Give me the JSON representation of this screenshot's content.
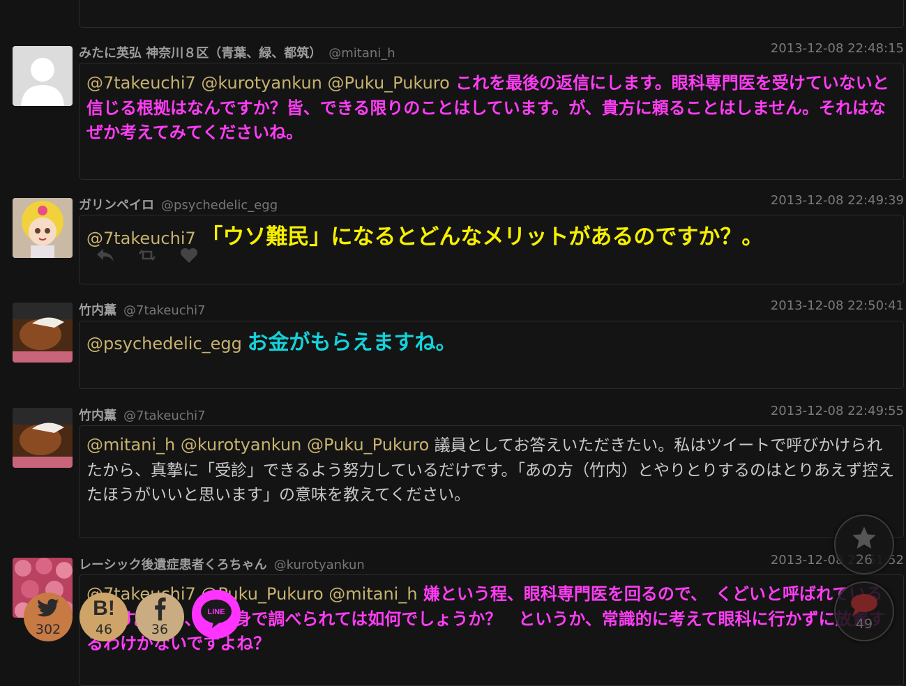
{
  "tweets": [
    {
      "name": "みたに英弘 神奈川８区（青葉、緑、都筑）",
      "handle": "@mitani_h",
      "time": "2013-12-08 22:48:15",
      "mentions": "@7takeuchi7 @kurotyankun @Puku_Pukuro",
      "text": "これを最後の返信にします。眼科専門医を受けていないと信じる根拠はなんですか？皆、できる限りのことはしています。が、貴方に頼ることはしません。それはなぜか考えてみてくださいね。"
    },
    {
      "name": "ガリンペイロ",
      "handle": "@psychedelic_egg",
      "time": "2013-12-08 22:49:39",
      "mentions": "@7takeuchi7",
      "text": "「ウソ難民」になるとどんなメリットがあるのですか？。"
    },
    {
      "name": "竹内薫",
      "handle": "@7takeuchi7",
      "time": "2013-12-08 22:50:41",
      "mentions": "@psychedelic_egg",
      "text": "お金がもらえますね。"
    },
    {
      "name": "竹内薫",
      "handle": "@7takeuchi7",
      "time": "2013-12-08 22:49:55",
      "mentions": "@mitani_h @kurotyankun @Puku_Pukuro",
      "text": "議員としてお答えいただきたい。私はツイートで呼びかけられたから、真摯に「受診」できるよう努力しているだけです。「あの方（竹内）とやりとりするのはとりあえず控えたほうがいいと思います」の意味を教えてください。"
    },
    {
      "name": "レーシック後遺症患者くろちゃん",
      "handle": "@kurotyankun",
      "time": "2013-12-08 22:51:52",
      "mentions": "@7takeuchi7 @Puku_Pukuro @mitani_h",
      "text": "嫌という程、眼科専門医を回るので、　くどいと呼ばれているんです。少し、ご自身で調べられては如何でしょうか？　というか、常識的に考えて眼科に行かずに放置するわけがないですよね？"
    }
  ],
  "floating": {
    "favorites": "26",
    "comments": "49"
  },
  "share": {
    "twitter": "302",
    "hatena_label": "B!",
    "hatena": "46",
    "facebook": "36",
    "line_label": "LINE"
  },
  "icons": [
    "reply-icon",
    "retweet-icon",
    "heart-icon",
    "star-icon",
    "comment-icon",
    "twitter-icon",
    "hatena-icon",
    "facebook-icon",
    "line-icon"
  ],
  "colors": {
    "magenta": "#ff3df5",
    "yellow": "#f6f000",
    "cyan": "#14d2da",
    "mention": "#c8b26f"
  }
}
